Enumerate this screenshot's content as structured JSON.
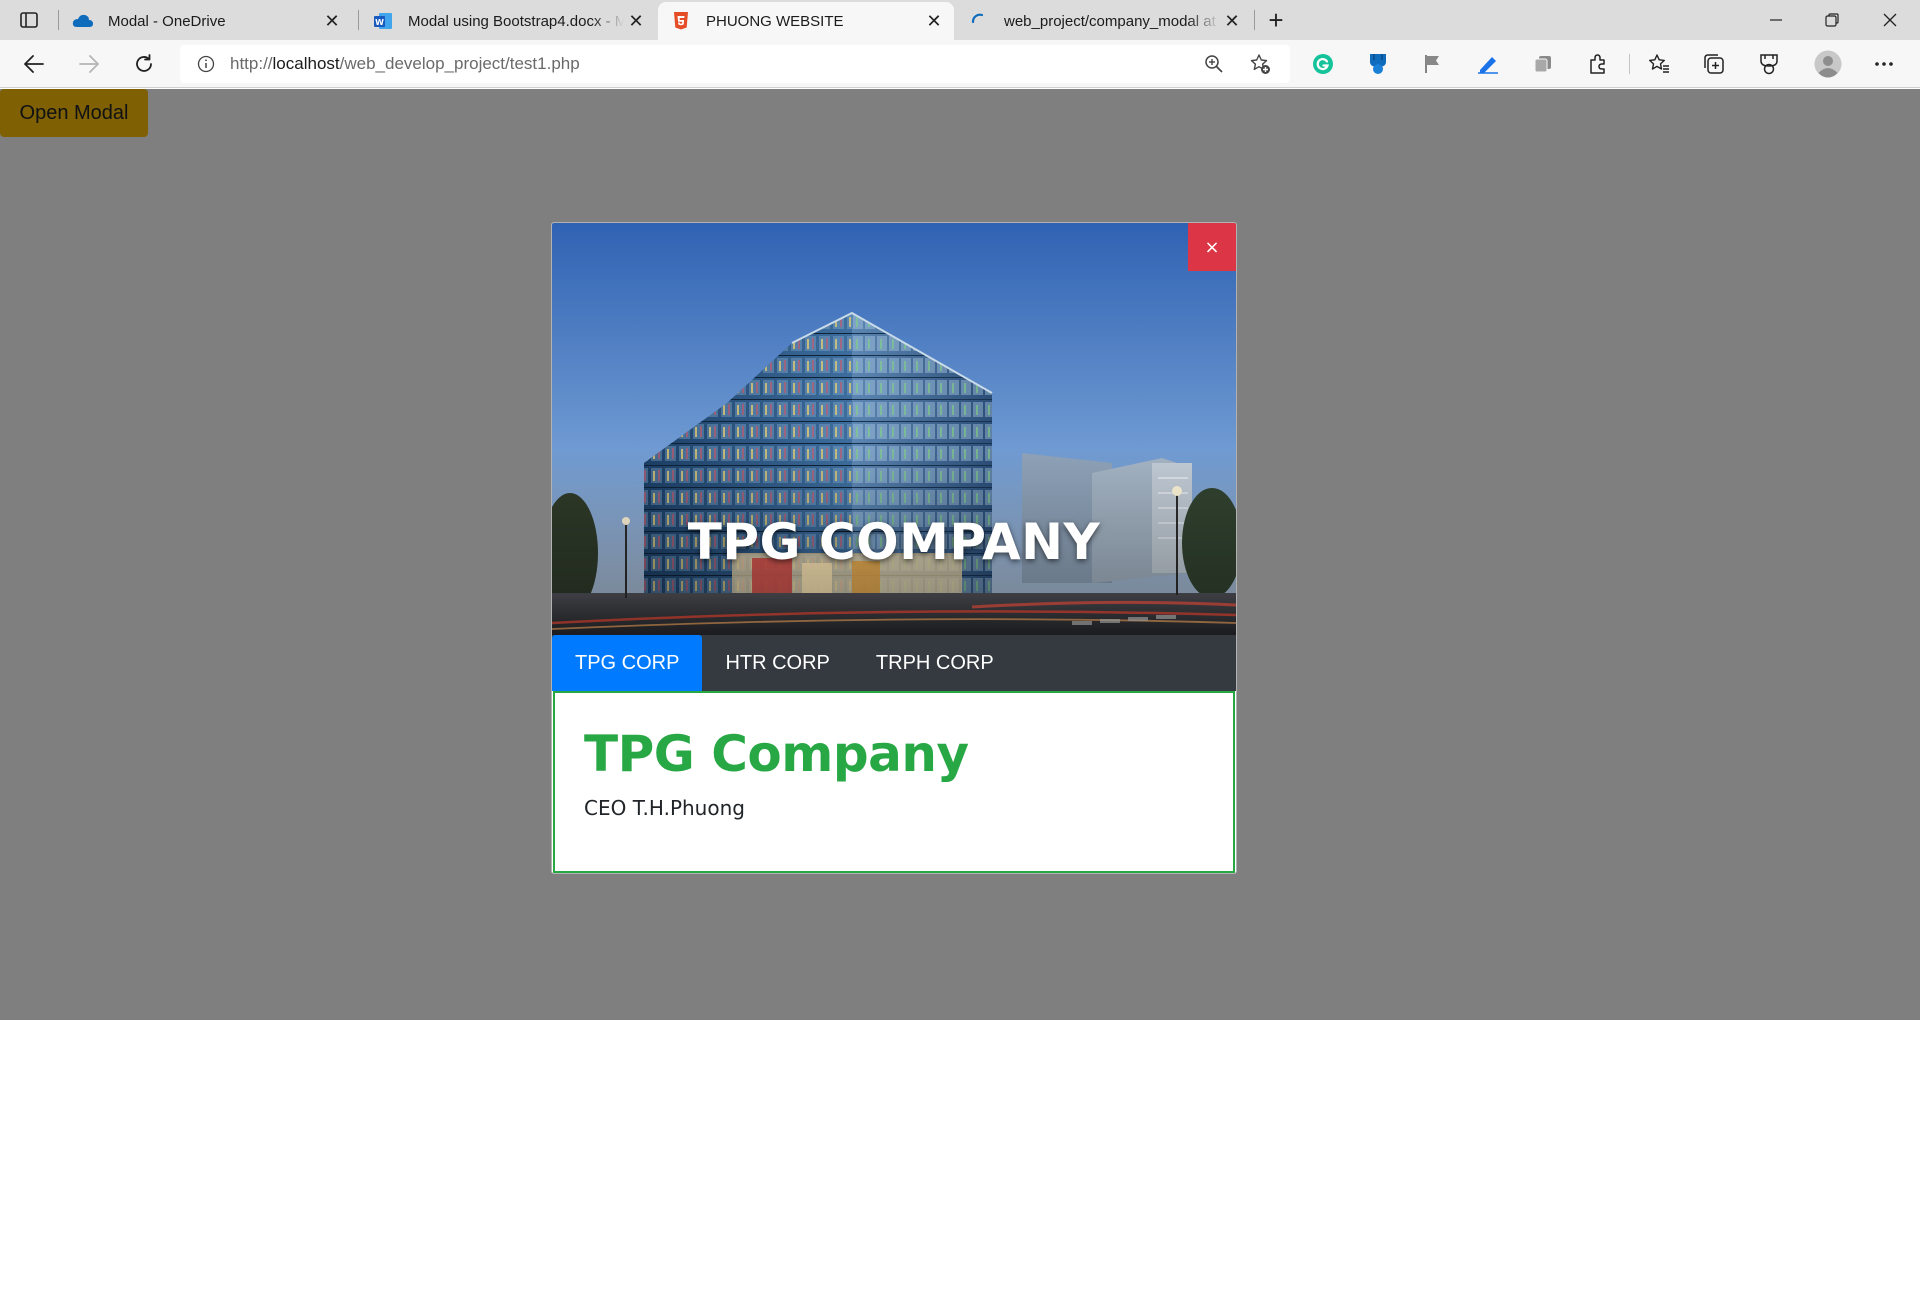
{
  "browser": {
    "tabs": [
      {
        "title": "Modal - OneDrive",
        "icon": "onedrive-icon",
        "active": false
      },
      {
        "title": "Modal using Bootstrap4.docx - M",
        "icon": "word-icon",
        "active": false
      },
      {
        "title": "PHUONG WEBSITE",
        "icon": "html5-icon",
        "active": true
      },
      {
        "title": "web_project/company_modal at",
        "icon": "loading-icon",
        "active": false
      }
    ],
    "address": {
      "prefix": "http://",
      "host": "localhost",
      "path": "/web_develop_project/test1.php"
    }
  },
  "page": {
    "open_modal_label": "Open Modal",
    "colors": {
      "button": "#ffc107",
      "close": "#dc3545",
      "nav": "#343a40",
      "nav_active": "#007bff",
      "accent": "#28a745"
    }
  },
  "modal": {
    "hero_title": "TPG COMPANY",
    "close_label": "×",
    "nav_tabs": [
      {
        "label": "TPG CORP",
        "active": true
      },
      {
        "label": "HTR CORP",
        "active": false
      },
      {
        "label": "TRPH CORP",
        "active": false
      }
    ],
    "content": {
      "title": "TPG Company",
      "subtitle": "CEO T.H.Phuong"
    }
  }
}
